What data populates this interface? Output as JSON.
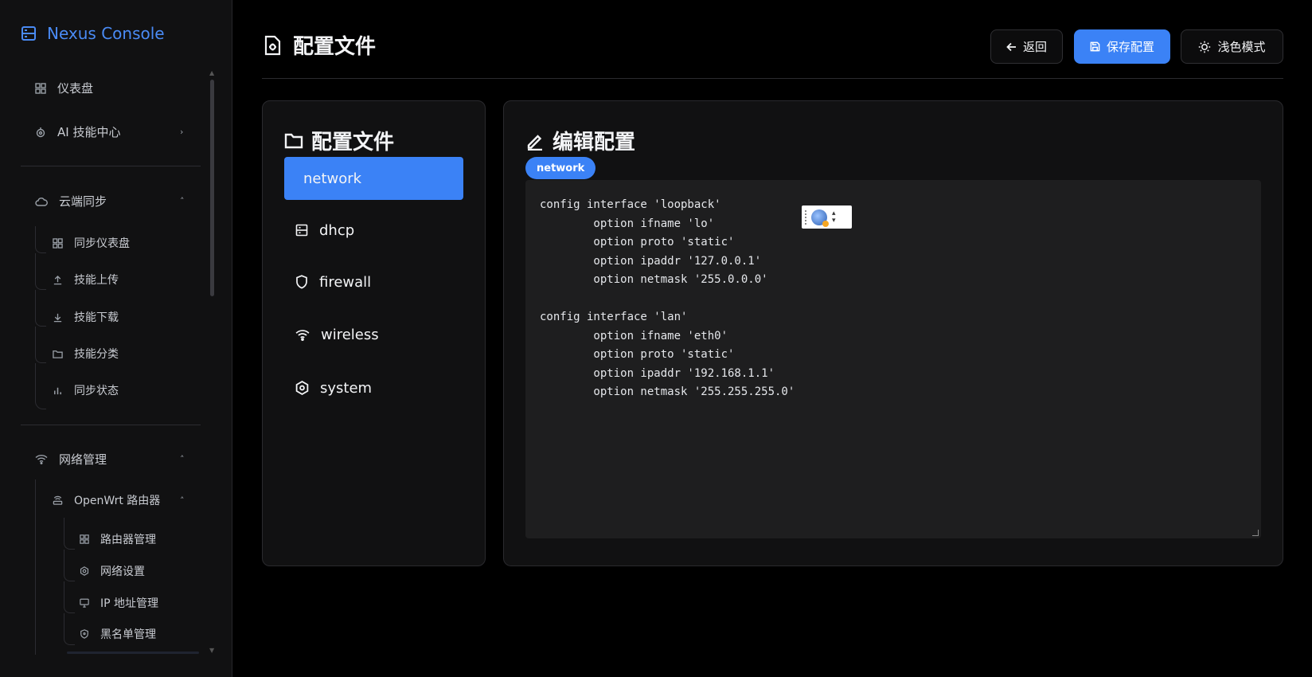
{
  "app": {
    "name": "Nexus Console"
  },
  "sidebar": {
    "items": [
      {
        "label": "仪表盘"
      },
      {
        "label": "AI 技能中心"
      },
      {
        "label": "云端同步"
      },
      {
        "label": "同步仪表盘"
      },
      {
        "label": "技能上传"
      },
      {
        "label": "技能下载"
      },
      {
        "label": "技能分类"
      },
      {
        "label": "同步状态"
      },
      {
        "label": "网络管理"
      },
      {
        "label": "OpenWrt 路由器"
      },
      {
        "label": "路由器管理"
      },
      {
        "label": "网络设置"
      },
      {
        "label": "IP 地址管理"
      },
      {
        "label": "黑名单管理"
      }
    ]
  },
  "header": {
    "title": "配置文件",
    "back_label": "返回",
    "save_label": "保存配置",
    "theme_label": "浅色模式"
  },
  "files_panel": {
    "title": "配置文件",
    "files": [
      {
        "name": "network",
        "icon": "file-icon",
        "active": true
      },
      {
        "name": "dhcp",
        "icon": "server-icon",
        "active": false
      },
      {
        "name": "firewall",
        "icon": "shield-icon",
        "active": false
      },
      {
        "name": "wireless",
        "icon": "wifi-icon",
        "active": false
      },
      {
        "name": "system",
        "icon": "hexagon-icon",
        "active": false
      }
    ]
  },
  "editor_panel": {
    "title": "编辑配置",
    "badge": "network",
    "content": "config interface 'loopback'\n        option ifname 'lo'\n        option proto 'static'\n        option ipaddr '127.0.0.1'\n        option netmask '255.0.0.0'\n\nconfig interface 'lan'\n        option ifname 'eth0'\n        option proto 'static'\n        option ipaddr '192.168.1.1'\n        option netmask '255.255.255.0'"
  },
  "colors": {
    "accent": "#3b82f6",
    "brand": "#4a8bf5",
    "background": "#000000",
    "panel": "#111112",
    "editor": "#1e1e1f"
  }
}
